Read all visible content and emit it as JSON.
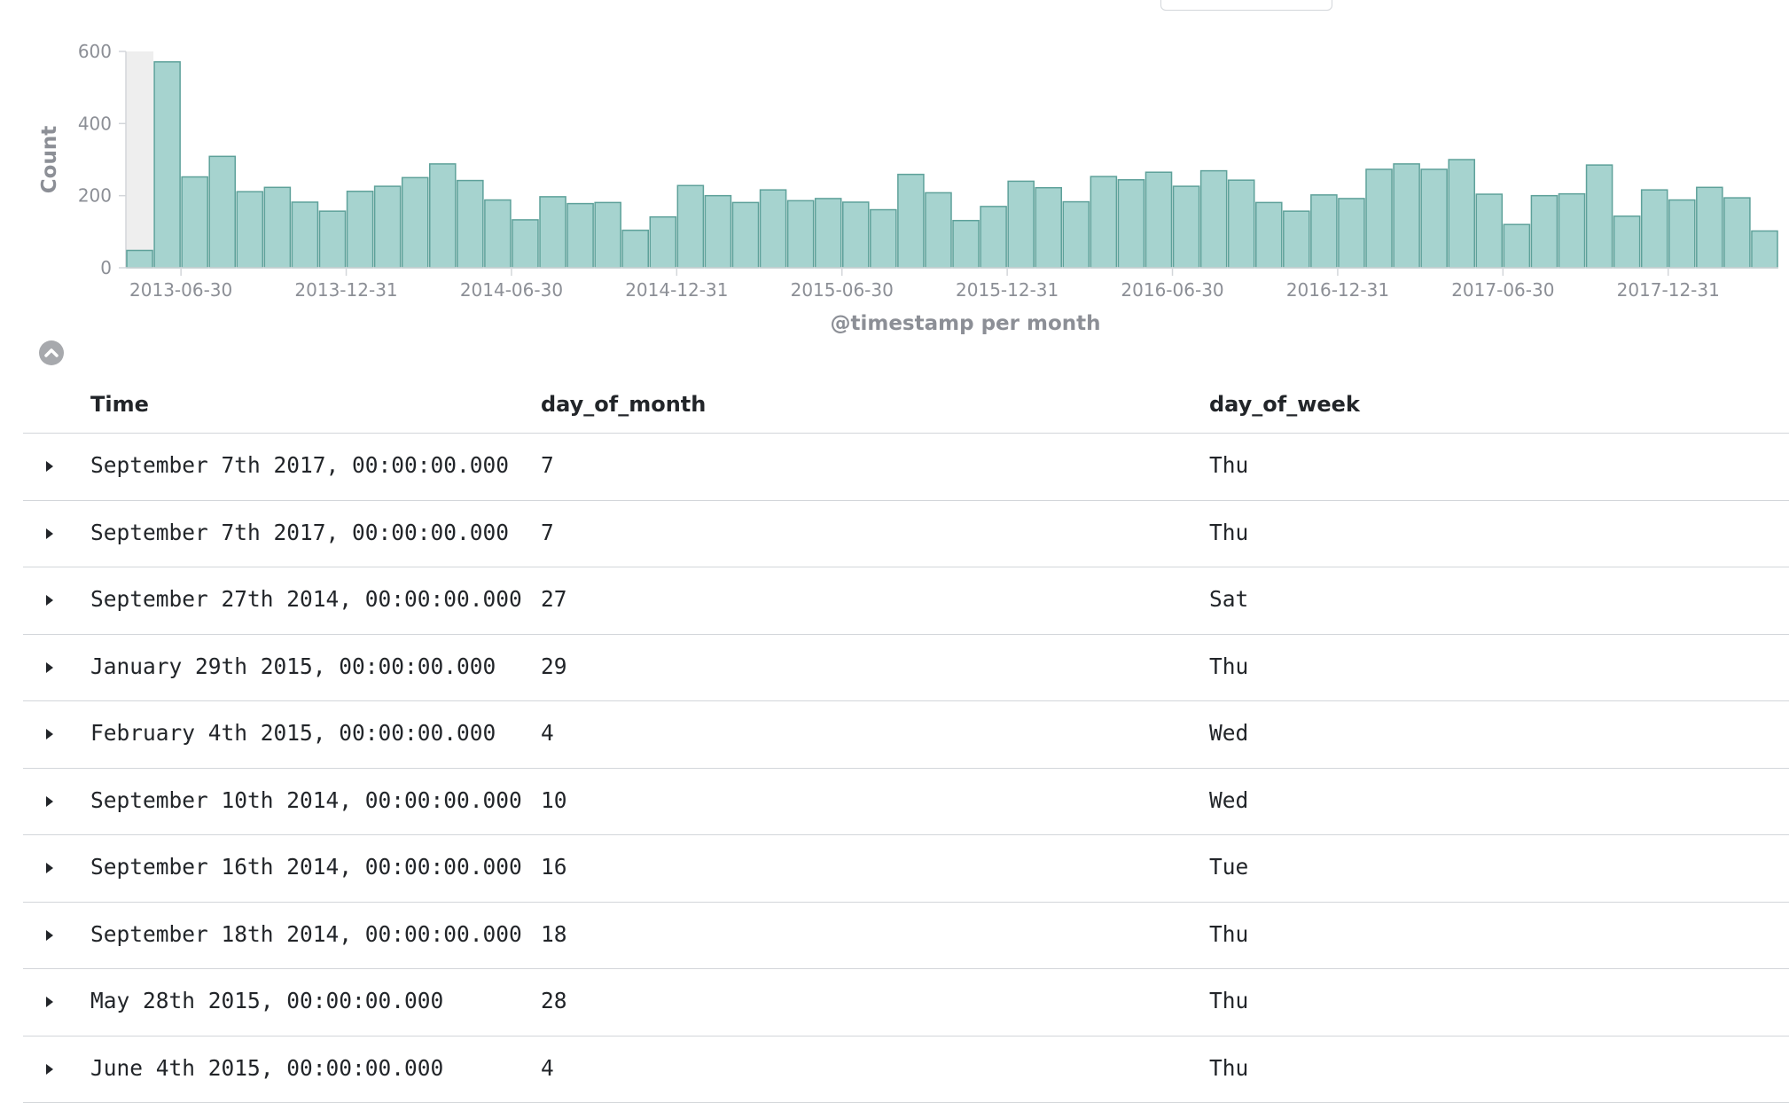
{
  "chart_data": {
    "type": "bar",
    "xlabel": "@timestamp per month",
    "ylabel": "Count",
    "ylim": [
      0,
      600
    ],
    "y_ticks": [
      "0",
      "200",
      "400",
      "600"
    ],
    "x_tick_labels": [
      "2013-06-30",
      "2013-12-31",
      "2014-06-30",
      "2014-12-31",
      "2015-06-30",
      "2015-12-31",
      "2016-06-30",
      "2016-12-31",
      "2017-06-30",
      "2017-12-31"
    ],
    "months": [
      "2013-05",
      "2013-06",
      "2013-07",
      "2013-08",
      "2013-09",
      "2013-10",
      "2013-11",
      "2013-12",
      "2014-01",
      "2014-02",
      "2014-03",
      "2014-04",
      "2014-05",
      "2014-06",
      "2014-07",
      "2014-08",
      "2014-09",
      "2014-10",
      "2014-11",
      "2014-12",
      "2015-01",
      "2015-02",
      "2015-03",
      "2015-04",
      "2015-05",
      "2015-06",
      "2015-07",
      "2015-08",
      "2015-09",
      "2015-10",
      "2015-11",
      "2015-12",
      "2016-01",
      "2016-02",
      "2016-03",
      "2016-04",
      "2016-05",
      "2016-06",
      "2016-07",
      "2016-08",
      "2016-09",
      "2016-10",
      "2016-11",
      "2016-12",
      "2017-01",
      "2017-02",
      "2017-03",
      "2017-04",
      "2017-05",
      "2017-06",
      "2017-07",
      "2017-08",
      "2017-09",
      "2017-10",
      "2017-11",
      "2017-12",
      "2018-01",
      "2018-02",
      "2018-03"
    ],
    "values": [
      48,
      571,
      252,
      309,
      211,
      223,
      182,
      157,
      212,
      226,
      250,
      288,
      242,
      188,
      133,
      197,
      178,
      181,
      104,
      141,
      228,
      200,
      181,
      216,
      186,
      192,
      182,
      161,
      259,
      208,
      131,
      170,
      240,
      222,
      183,
      253,
      244,
      265,
      226,
      269,
      243,
      181,
      157,
      202,
      192,
      273,
      288,
      273,
      300,
      204,
      120,
      200,
      205,
      285,
      143,
      216,
      188,
      223,
      194,
      102
    ],
    "grid": false,
    "legend": "none"
  },
  "table": {
    "headers": {
      "time": "Time",
      "day_of_month": "day_of_month",
      "day_of_week": "day_of_week"
    },
    "rows": [
      {
        "time": "September 7th 2017, 00:00:00.000",
        "day_of_month": "7",
        "day_of_week": "Thu"
      },
      {
        "time": "September 7th 2017, 00:00:00.000",
        "day_of_month": "7",
        "day_of_week": "Thu"
      },
      {
        "time": "September 27th 2014, 00:00:00.000",
        "day_of_month": "27",
        "day_of_week": "Sat"
      },
      {
        "time": "January 29th 2015, 00:00:00.000",
        "day_of_month": "29",
        "day_of_week": "Thu"
      },
      {
        "time": "February 4th 2015, 00:00:00.000",
        "day_of_month": "4",
        "day_of_week": "Wed"
      },
      {
        "time": "September 10th 2014, 00:00:00.000",
        "day_of_month": "10",
        "day_of_week": "Wed"
      },
      {
        "time": "September 16th 2014, 00:00:00.000",
        "day_of_month": "16",
        "day_of_week": "Tue"
      },
      {
        "time": "September 18th 2014, 00:00:00.000",
        "day_of_month": "18",
        "day_of_week": "Thu"
      },
      {
        "time": "May 28th 2015, 00:00:00.000",
        "day_of_month": "28",
        "day_of_week": "Thu"
      },
      {
        "time": "June 4th 2015, 00:00:00.000",
        "day_of_month": "4",
        "day_of_week": "Thu"
      }
    ]
  },
  "icons": {
    "toggle": "chevron-up-icon",
    "row_expander": "caret-right-icon"
  },
  "colors": {
    "bar_fill": "#a6d3cf",
    "bar_stroke": "#5ea19a",
    "axis_text": "#8c8f96",
    "brush_highlight": "#eeeeee"
  }
}
